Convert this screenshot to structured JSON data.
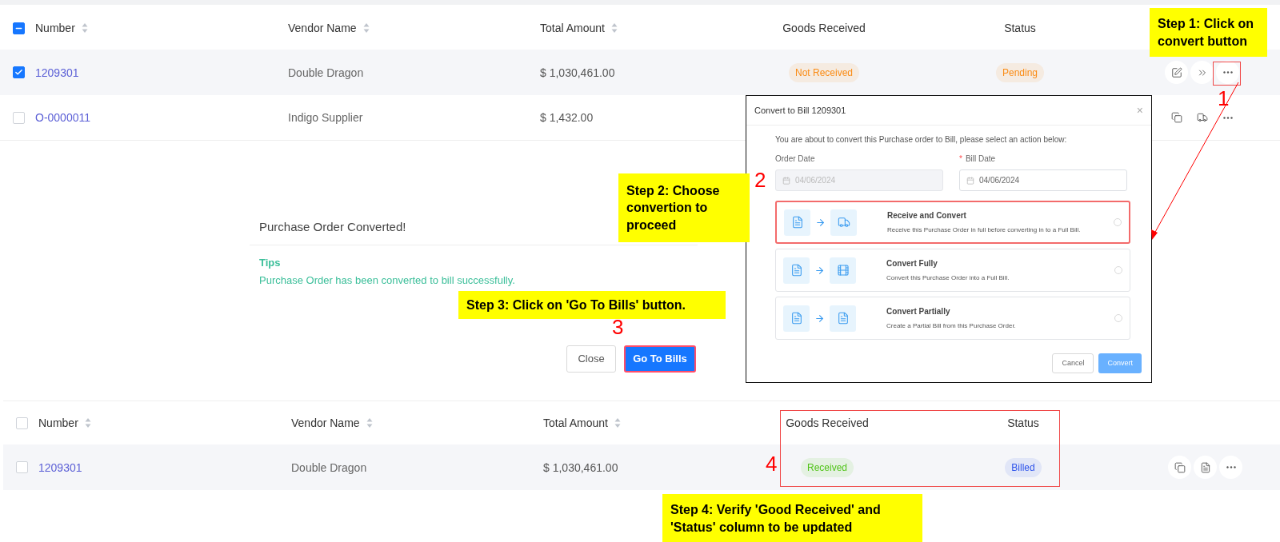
{
  "top_table": {
    "header_checkbox": {
      "indeterminate": true
    },
    "columns": [
      {
        "label": "Number",
        "sortable": true
      },
      {
        "label": "Vendor Name",
        "sortable": true
      },
      {
        "label": "Total Amount",
        "sortable": true
      },
      {
        "label": "Goods Received",
        "sortable": false
      },
      {
        "label": "Status",
        "sortable": false
      }
    ],
    "rows": [
      {
        "selected": true,
        "number": "1209301",
        "vendor": "Double Dragon",
        "total": "$ 1,030,461.00",
        "goods_received": {
          "text": "Not Received",
          "color": "#fa8c16"
        },
        "status": {
          "text": "Pending",
          "color": "#fa8c16"
        },
        "actions": [
          {
            "kind": "edit"
          },
          {
            "kind": "convert"
          },
          {
            "kind": "more"
          }
        ]
      },
      {
        "selected": false,
        "number": "O-0000011",
        "vendor": "Indigo Supplier",
        "total": "$ 1,432.00",
        "actions": [
          {
            "kind": "copy"
          },
          {
            "kind": "truck"
          },
          {
            "kind": "more"
          }
        ]
      }
    ]
  },
  "success_panel": {
    "title": "Purchase Order Converted!",
    "tips_label": "Tips",
    "message": "Purchase Order has been converted to bill successfully.",
    "buttons": [
      {
        "label": "Close",
        "kind": "default"
      },
      {
        "label": "Go To Bills",
        "kind": "primary"
      }
    ]
  },
  "convert_dialog": {
    "title": "Convert to Bill 1209301",
    "close": "×",
    "intro": "You are about to convert this Purchase order to Bill, please select an action below:",
    "fields": [
      {
        "label": "Order Date",
        "value": "04/06/2024",
        "required": false,
        "disabled": true
      },
      {
        "label": "Bill Date",
        "required_mark": "*",
        "value": "04/06/2024",
        "required": true,
        "disabled": false
      }
    ],
    "options": [
      {
        "title": "Receive and Convert",
        "description": "Receive this Purchase Order in full before converting in to a Full Bill.",
        "kind": "truck",
        "selected": false
      },
      {
        "title": "Convert Fully",
        "description": "Convert this Purchase Order into a Full Bill.",
        "kind": "film",
        "selected": false
      },
      {
        "title": "Convert Partially",
        "description": "Create a Partial Bill from this Purchase Order.",
        "kind": "document",
        "selected": false
      }
    ],
    "buttons": [
      {
        "label": "Cancel",
        "kind": "default"
      },
      {
        "label": "Convert",
        "kind": "primary",
        "disabled": true
      }
    ]
  },
  "bottom_table": {
    "header_checkbox": {
      "indeterminate": false
    },
    "columns": [
      {
        "label": "Number",
        "sortable": true
      },
      {
        "label": "Vendor Name",
        "sortable": true
      },
      {
        "label": "Total Amount",
        "sortable": true
      },
      {
        "label": "Goods Received",
        "sortable": false
      },
      {
        "label": "Status",
        "sortable": false
      }
    ],
    "rows": [
      {
        "selected": false,
        "number": "1209301",
        "vendor": "Double Dragon",
        "total": "$ 1,030,461.00",
        "goods_received": {
          "text": "Received",
          "color": "#52c41a"
        },
        "status": {
          "text": "Billed",
          "color": "#2f54eb"
        },
        "actions": [
          {
            "kind": "copy"
          },
          {
            "kind": "document"
          },
          {
            "kind": "more"
          }
        ]
      }
    ]
  },
  "annotations": [
    {
      "step": "1",
      "text": "Step 1: Click on convert button"
    },
    {
      "step": "2",
      "text": "Step 2: Choose convertion to proceed"
    },
    {
      "step": "3",
      "text": "Step 3: Click on 'Go To Bills' button."
    },
    {
      "step": "4",
      "text": "Step 4: Verify 'Good Received' and 'Status' column to be updated"
    }
  ]
}
